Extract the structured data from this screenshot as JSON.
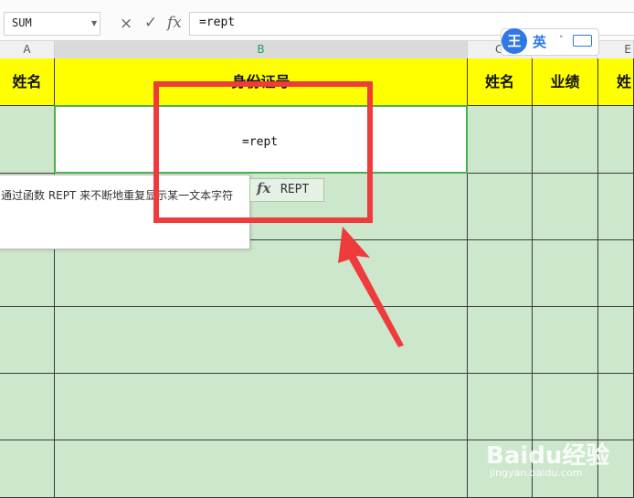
{
  "formula_bar": {
    "name_box": "SUM",
    "cancel_icon": "×",
    "confirm_icon": "✓",
    "fx_label": "fx",
    "formula": "=rept"
  },
  "columns": [
    "A",
    "B",
    "C",
    "D",
    "E"
  ],
  "headers": {
    "a": "姓名",
    "b": "身份证号",
    "c": "姓名",
    "d": "业绩",
    "e": "姓"
  },
  "active_cell_text": "=rept",
  "tooltip_text": "通过函数 REPT 来不断地重复显示某一文本字符",
  "suggestion": {
    "fx": "fx",
    "name": "REPT"
  },
  "ime": {
    "logo": "王",
    "lang": "英"
  },
  "watermark": {
    "brand": "Baidu经验",
    "url": "jingyan.baidu.com"
  },
  "colors": {
    "header_fill": "#ffff00",
    "cell_fill": "#cde7cd",
    "annotation": "#ef3b3b",
    "active_border": "#4caf50"
  }
}
